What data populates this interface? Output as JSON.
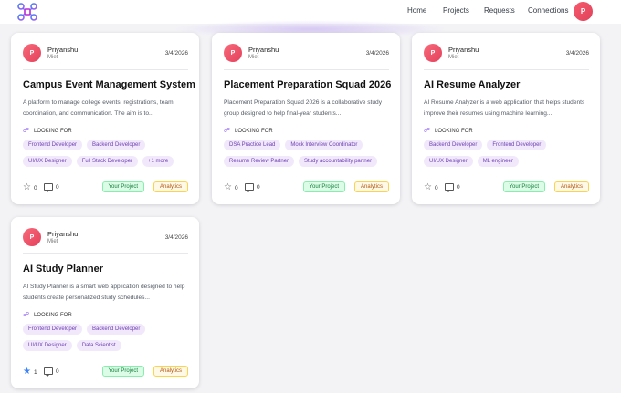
{
  "nav": {
    "logo_icon": "network-logo-icon",
    "links": [
      "Home",
      "Projects",
      "Requests",
      "Connections"
    ],
    "avatar_initial": "P"
  },
  "colors": {
    "accent": "#8b5cf6",
    "avatar": "#f0506a",
    "project_badge": "#dcfce7",
    "analytics_badge": "#fef9e7"
  },
  "cards": [
    {
      "avatar_initial": "P",
      "owner": "Priyanshu",
      "college": "Miet",
      "date": "3/4/2026",
      "title": "Campus Event Management System",
      "description": "A platform to manage college events, registrations, team coordination, and communication. The aim is to...",
      "looking_for_label": "LOOKING FOR",
      "tags": [
        "Frontend Developer",
        "Backend Developer",
        "UI/UX Designer",
        "Full Stack Developer",
        "+1 more"
      ],
      "stars": "0",
      "comments": "0",
      "project_badge": "Your Project",
      "analytics_badge": "Analytics"
    },
    {
      "avatar_initial": "P",
      "owner": "Priyanshu",
      "college": "Miet",
      "date": "3/4/2026",
      "title": "Placement Preparation Squad 2026",
      "description": "Placement Preparation Squad 2026 is a collaborative study group designed to help final-year students...",
      "looking_for_label": "LOOKING FOR",
      "tags": [
        "DSA Practice Lead",
        "Mock Interview Coordinator",
        "Resume Review Partner",
        "Study accountability partner"
      ],
      "stars": "0",
      "comments": "0",
      "project_badge": "Your Project",
      "analytics_badge": "Analytics"
    },
    {
      "avatar_initial": "P",
      "owner": "Priyanshu",
      "college": "Miet",
      "date": "3/4/2026",
      "title": "AI Resume Analyzer",
      "description": "AI Resume Analyzer is a web application that helps students improve their resumes using machine learning...",
      "looking_for_label": "LOOKING FOR",
      "tags": [
        "Backend Developer",
        "Frontend Developer",
        "UI/UX Designer",
        "ML engineer"
      ],
      "stars": "0",
      "comments": "0",
      "project_badge": "Your Project",
      "analytics_badge": "Analytics"
    },
    {
      "avatar_initial": "P",
      "owner": "Priyanshu",
      "college": "Miet",
      "date": "3/4/2026",
      "title": "AI Study Planner",
      "description": "AI Study Planner is a smart web application designed to help students create personalized study schedules...",
      "looking_for_label": "LOOKING FOR",
      "tags": [
        "Frontend Developer",
        "Backend Developer",
        "UI/UX Designer",
        "Data Scientist"
      ],
      "stars": "1",
      "comments": "0",
      "starred": true,
      "project_badge": "Your Project",
      "analytics_badge": "Analytics"
    }
  ]
}
